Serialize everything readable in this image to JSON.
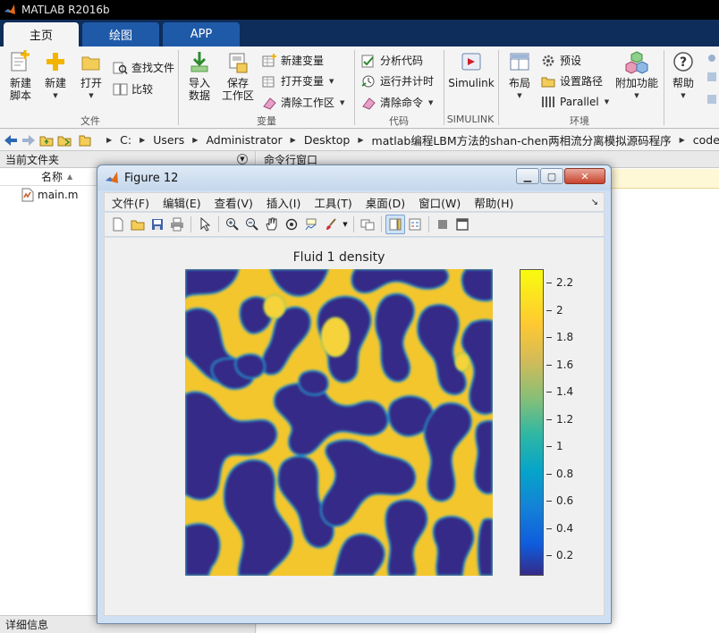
{
  "window": {
    "title": "MATLAB R2016b"
  },
  "ribbon_tabs": [
    {
      "label": "主页",
      "active": true
    },
    {
      "label": "绘图",
      "active": false
    },
    {
      "label": "APP",
      "active": false
    }
  ],
  "ribbon": {
    "file": {
      "new_script": "新建\n脚本",
      "new": "新建",
      "open": "打开",
      "find_files": "查找文件",
      "compare": "比较",
      "group_label": "文件"
    },
    "variable": {
      "import": "导入\n数据",
      "save_workspace": "保存\n工作区",
      "new_variable": "新建变量",
      "open_variable": "打开变量",
      "clear_workspace": "清除工作区",
      "group_label": "变量"
    },
    "code": {
      "analyze": "分析代码",
      "run_time": "运行并计时",
      "clear_commands": "清除命令",
      "group_label": "代码"
    },
    "simulink": {
      "simulink": "Simulink",
      "group_label": "SIMULINK"
    },
    "environment": {
      "layout": "布局",
      "preferences": "预设",
      "set_path": "设置路径",
      "parallel": "Parallel",
      "addons": "附加功能",
      "group_label": "环境"
    },
    "resources": {
      "help": "帮助"
    }
  },
  "address_bar": {
    "path": [
      "C:",
      "Users",
      "Administrator",
      "Desktop",
      "matlab编程LBM方法的shan-chen两相流分离模拟源码程序",
      "code"
    ]
  },
  "current_folder": {
    "title": "当前文件夹",
    "column_name": "名称",
    "sort_indicator": "▲",
    "files": [
      {
        "name": "main.m",
        "icon": "m-file-icon"
      }
    ],
    "details_title": "详细信息"
  },
  "command_window": {
    "title": "命令行窗口"
  },
  "figure": {
    "title": "Figure 12",
    "menus": [
      "文件(F)",
      "编辑(E)",
      "查看(V)",
      "插入(I)",
      "工具(T)",
      "桌面(D)",
      "窗口(W)",
      "帮助(H)"
    ],
    "menu_overflow": "↘",
    "toolbar_icons": [
      "new-figure-icon",
      "open-file-icon",
      "save-icon",
      "print-icon",
      "edit-plot-arrow-icon",
      "zoom-in-icon",
      "zoom-out-icon",
      "pan-hand-icon",
      "rotate-3d-icon",
      "data-cursor-icon",
      "brush-icon",
      "link-plot-icon",
      "colorbar-toggle-icon",
      "legend-toggle-icon",
      "hide-plot-tools-icon",
      "show-plot-tools-icon"
    ],
    "plot_title": "Fluid 1 density",
    "colorbar": {
      "ticks": [
        "2.2",
        "2",
        "1.8",
        "1.6",
        "1.4",
        "1.2",
        "1",
        "0.8",
        "0.6",
        "0.4",
        "0.2"
      ],
      "tick_values": [
        2.2,
        2.0,
        1.8,
        1.6,
        1.4,
        1.2,
        1.0,
        0.8,
        0.6,
        0.4,
        0.2
      ],
      "min": 0.05,
      "max": 2.3
    }
  },
  "colors": {
    "matlab_titlebar": "#000000",
    "ribbon_tabrow": "#0e2d5a",
    "ribbon_tab_inactive": "#1f5aa8",
    "parula_low": "#352a87",
    "parula_high": "#f9fb0e",
    "density_high": "#f5cd2a"
  }
}
